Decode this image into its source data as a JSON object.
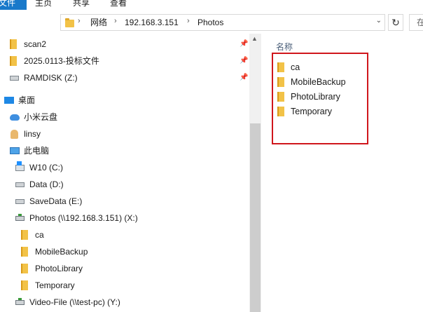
{
  "ribbon": {
    "tabs": [
      "文件",
      "主页",
      "共享",
      "查看"
    ]
  },
  "address": {
    "crumbs": [
      "网络",
      "192.168.3.151",
      "Photos"
    ],
    "separator": "›",
    "dropdown": "⌄",
    "refresh": "↻",
    "search_prefix": "在"
  },
  "nav": {
    "quick_access": [
      {
        "label": "scan2",
        "pinned": true
      },
      {
        "label": "2025.0113-投标文件",
        "pinned": true
      },
      {
        "label": "RAMDISK (Z:)",
        "pinned": true
      }
    ],
    "desktop": "桌面",
    "cloud": "小米云盘",
    "user": "linsy",
    "this_pc": "此电脑",
    "drives": [
      "W10 (C:)",
      "Data (D:)",
      "SaveData (E:)",
      "Photos (\\\\192.168.3.151) (X:)"
    ],
    "photos_children": [
      "ca",
      "MobileBackup",
      "PhotoLibrary",
      "Temporary"
    ],
    "video_drive": "Video-File (\\\\test-pc) (Y:)"
  },
  "content": {
    "column_name": "名称",
    "items": [
      "ca",
      "MobileBackup",
      "PhotoLibrary",
      "Temporary"
    ]
  },
  "colors": {
    "accent": "#1979ca",
    "highlight": "#d0161c",
    "folder": "#f2c247"
  }
}
